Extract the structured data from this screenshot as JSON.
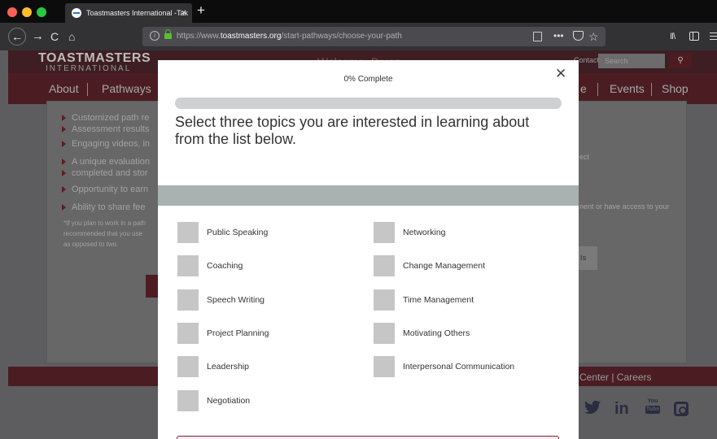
{
  "browser": {
    "tab_title": "Toastmasters International -Tak",
    "tab_close": "×",
    "new_tab": "+",
    "url_prefix": "https://www.",
    "url_domain": "toastmasters.org",
    "url_path": "/start-pathways/choose-your-path",
    "more_icon": "•••",
    "star_icon": "☆",
    "library_icon": "II\\",
    "back_icon": "←",
    "forward_icon": "→",
    "reload_icon": "C",
    "home_icon": "⌂"
  },
  "site": {
    "logo_line1": "TOASTMASTERS",
    "logo_line2": "INTERNATIONAL",
    "welcome": "Welcome, Bryan",
    "header_links": "Contact Us",
    "search_placeholder": "Search",
    "search_button": "⚲",
    "nav": {
      "about": "About",
      "pathways": "Pathways",
      "partial": "e",
      "events": "Events",
      "shop": "Shop"
    },
    "bullets": [
      "Customized path re",
      "Assessment results",
      "Engaging videos, in",
      "A unique evaluation",
      "completed and stor",
      "Opportunity to earn",
      "Ability to share fee"
    ],
    "note_lines": [
      "*If you plan to work in a path",
      "recommended that you use",
      "as opposed to two."
    ],
    "right_fragments": [
      "ect",
      "nent or have access to your"
    ],
    "button_fragment": "ls",
    "footer_links": "Center  |  Careers",
    "social": {
      "twitter": "twitter-icon",
      "linkedin": "in",
      "youtube_top": "You",
      "youtube_bottom": "Tube",
      "instagram": "instagram-icon"
    }
  },
  "modal": {
    "progress_label": "0% Complete",
    "progress_value": 0,
    "close_icon": "✕",
    "heading": "Select three topics you are interested in learning about from the list below.",
    "accent_color": "#772432",
    "topics_left": [
      "Public Speaking",
      "Coaching",
      "Speech Writing",
      "Project Planning",
      "Leadership",
      "Negotiation"
    ],
    "topics_right": [
      "Networking",
      "Change Management",
      "Time Management",
      "Motivating Others",
      "Interpersonal Communication"
    ]
  }
}
